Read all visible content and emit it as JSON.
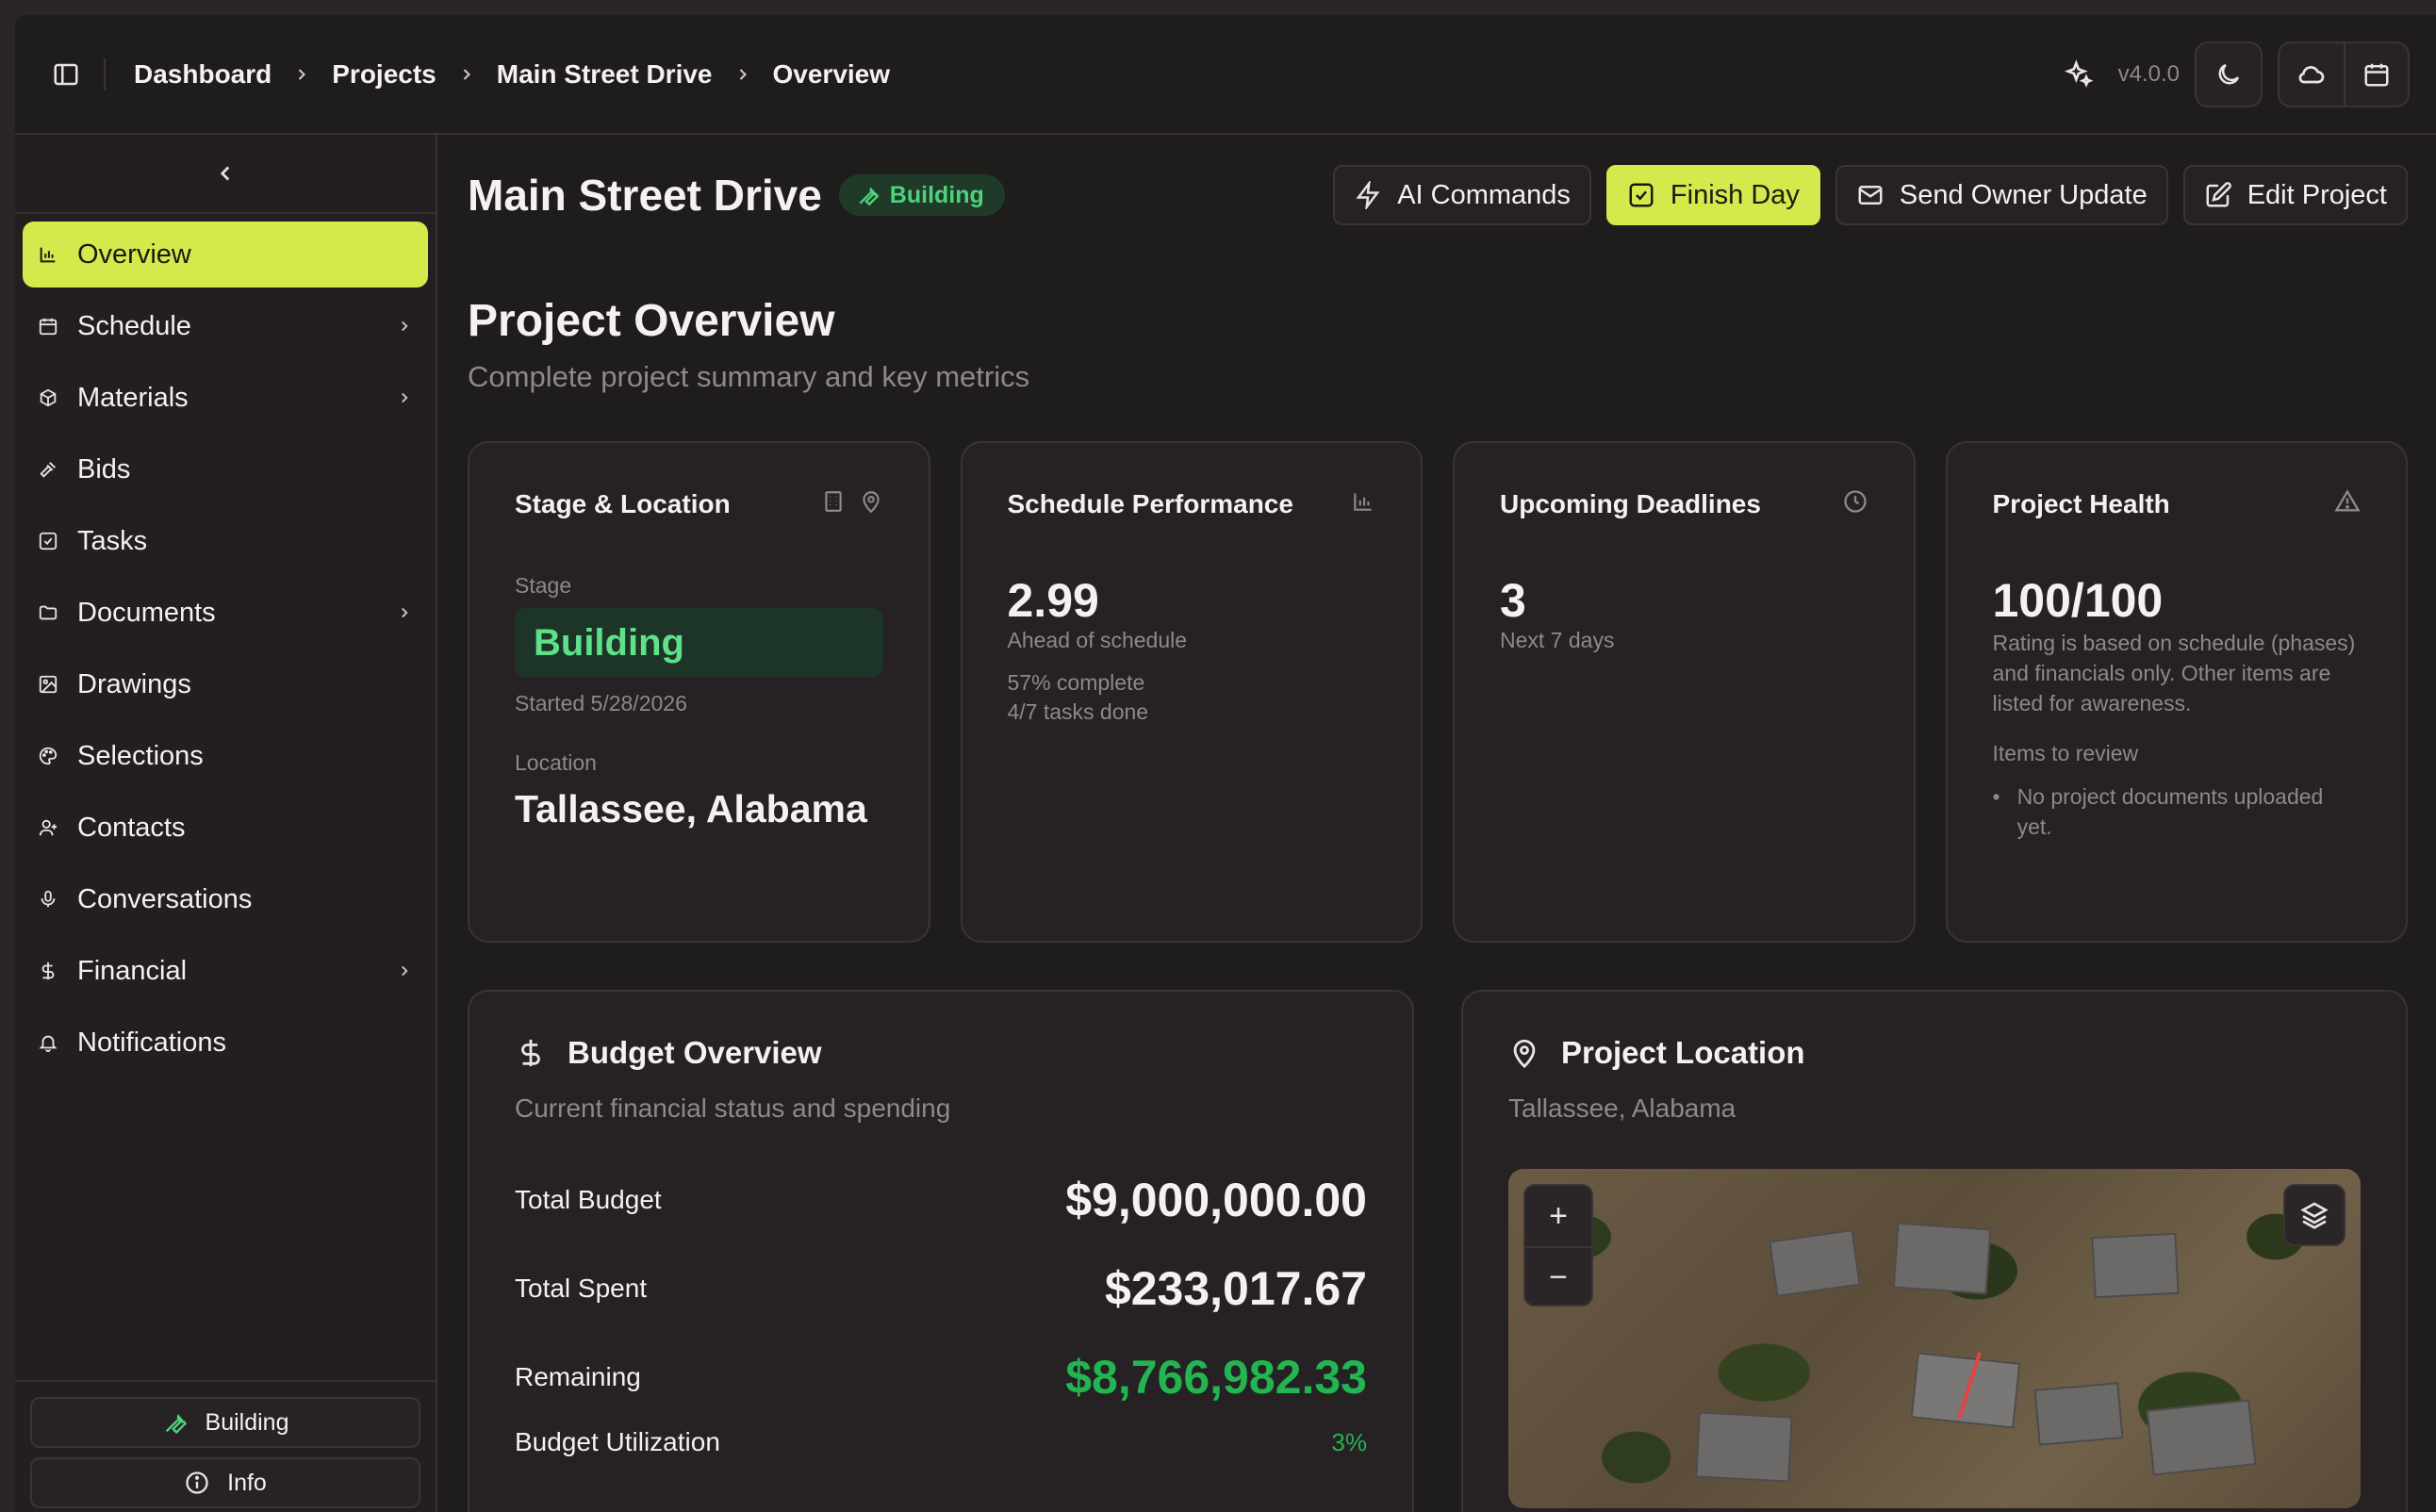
{
  "breadcrumbs": [
    "Dashboard",
    "Projects",
    "Main Street Drive",
    "Overview"
  ],
  "version": "v4.0.0",
  "sidebar": {
    "items": [
      {
        "label": "Overview",
        "icon": "bar-chart-icon"
      },
      {
        "label": "Schedule",
        "icon": "calendar-icon"
      },
      {
        "label": "Materials",
        "icon": "box-icon"
      },
      {
        "label": "Bids",
        "icon": "gavel-icon"
      },
      {
        "label": "Tasks",
        "icon": "checkbox-icon"
      },
      {
        "label": "Documents",
        "icon": "folder-icon"
      },
      {
        "label": "Drawings",
        "icon": "image-icon"
      },
      {
        "label": "Selections",
        "icon": "palette-icon"
      },
      {
        "label": "Contacts",
        "icon": "user-icon"
      },
      {
        "label": "Conversations",
        "icon": "mic-icon"
      },
      {
        "label": "Financial",
        "icon": "dollar-icon"
      },
      {
        "label": "Notifications",
        "icon": "bell-icon"
      }
    ],
    "bottom_status": "Building",
    "bottom_info": "Info"
  },
  "header": {
    "title": "Main Street Drive",
    "status": "Building",
    "actions": {
      "ai": "AI Commands",
      "finish": "Finish Day",
      "send": "Send Owner Update",
      "edit": "Edit Project"
    }
  },
  "overview": {
    "title": "Project Overview",
    "subtitle": "Complete project summary and key metrics"
  },
  "cards": {
    "stage": {
      "title": "Stage & Location",
      "stage_label": "Stage",
      "stage": "Building",
      "started": "Started 5/28/2026",
      "location_label": "Location",
      "location": "Tallassee, Alabama"
    },
    "schedule": {
      "title": "Schedule Performance",
      "value": "2.99",
      "caption": "Ahead of schedule",
      "complete": "57% complete",
      "tasks": "4/7 tasks done"
    },
    "deadlines": {
      "title": "Upcoming Deadlines",
      "value": "3",
      "caption": "Next 7 days"
    },
    "health": {
      "title": "Project Health",
      "value": "100/100",
      "note": "Rating is based on schedule (phases) and financials only. Other items are listed for awareness.",
      "review_label": "Items to review",
      "review_item": "No project documents uploaded yet."
    }
  },
  "budget": {
    "title": "Budget Overview",
    "subtitle": "Current financial status and spending",
    "total_label": "Total Budget",
    "total": "$9,000,000.00",
    "spent_label": "Total Spent",
    "spent": "$233,017.67",
    "remaining_label": "Remaining",
    "remaining": "$8,766,982.33",
    "util_label": "Budget Utilization",
    "util": "3%"
  },
  "location_panel": {
    "title": "Project Location",
    "subtitle": "Tallassee, Alabama",
    "zoom_in": "+",
    "zoom_out": "−"
  },
  "colors": {
    "accent": "#d4e94b",
    "status_green": "#4ed27a",
    "remaining_green": "#22b552",
    "background": "#1f1c1c"
  }
}
